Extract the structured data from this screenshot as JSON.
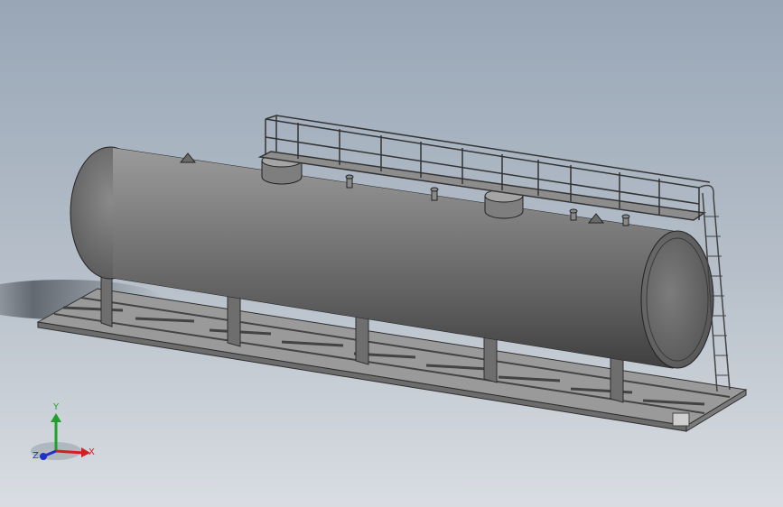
{
  "viewport": {
    "background_top": "#98a6b6",
    "background_bottom": "#d9dde2",
    "model": "horizontal-storage-tank-on-skid"
  },
  "triad": {
    "x_label": "X",
    "y_label": "Y",
    "z_label": "Z",
    "x_color": "#d42020",
    "y_color": "#1fa02a",
    "z_color": "#2030c8"
  }
}
